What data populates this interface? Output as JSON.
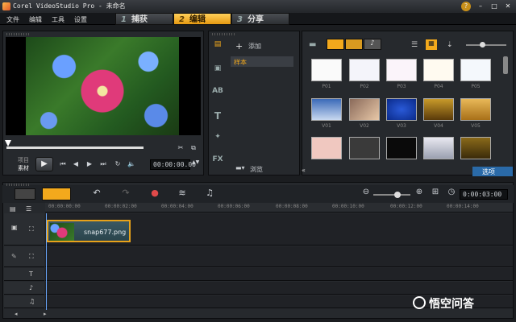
{
  "window": {
    "title": "Corel VideoStudio Pro - 未命名"
  },
  "menu": [
    "文件",
    "编辑",
    "工具",
    "设置"
  ],
  "steps": [
    {
      "num": "1",
      "label": "捕获"
    },
    {
      "num": "2",
      "label": "编辑"
    },
    {
      "num": "3",
      "label": "分享"
    }
  ],
  "preview": {
    "mode_project": "项目",
    "mode_clip": "素材",
    "timecode": "00:00:00.00"
  },
  "library": {
    "add_label": "添加",
    "folder_item": "样本",
    "browse_label": "浏览",
    "options_label": "选项",
    "thumbs": [
      [
        "P01",
        "P02",
        "P03",
        "P04",
        "P05"
      ],
      [
        "V01",
        "V02",
        "V03",
        "V04",
        "V05"
      ]
    ]
  },
  "timeline": {
    "timecode": "0:00:03:00",
    "ruler": [
      "00:00:00:00",
      "00:00:02:00",
      "00:00:04:00",
      "00:00:06:00",
      "00:00:08:00",
      "00:00:10:00",
      "00:00:12:00",
      "00:00:14:00"
    ],
    "clip_name": "snap677.png"
  },
  "watermark": "悟空问答",
  "colors": {
    "accent": "#f3a91c",
    "background": "#1b1d20"
  }
}
